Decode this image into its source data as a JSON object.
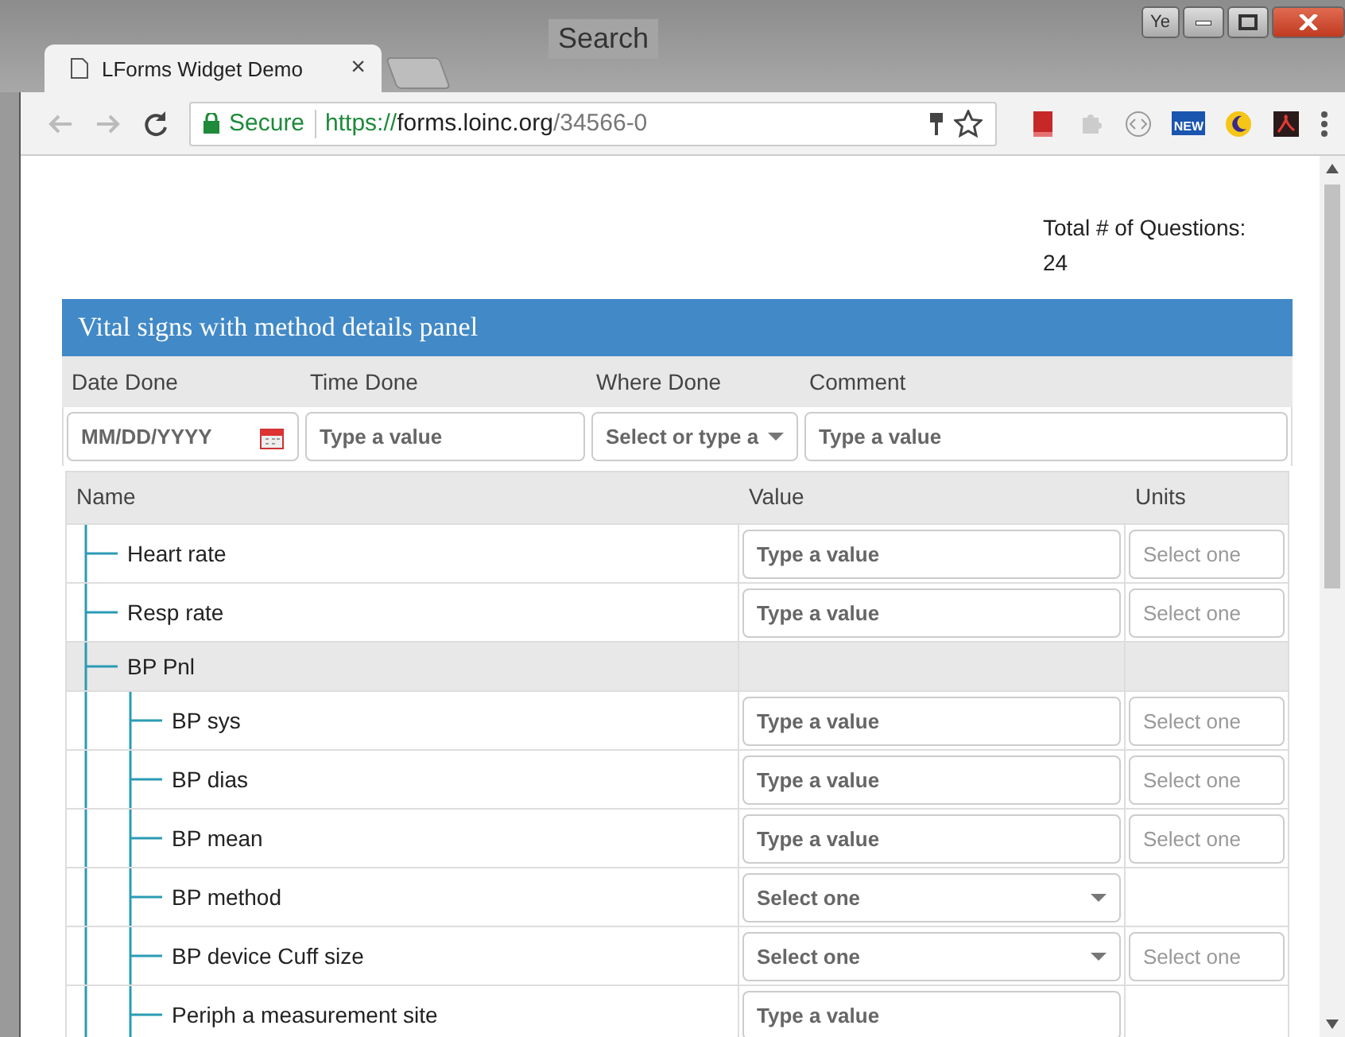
{
  "window": {
    "background_text": "Search",
    "profile": "Ye"
  },
  "tabs": [
    {
      "title": "LForms Widget Demo",
      "close": "×",
      "selected": true
    }
  ],
  "toolbar": {
    "security": "Secure",
    "url": {
      "scheme": "https://",
      "host": "forms.loinc.org",
      "path": "/34566-0"
    },
    "extensions": [
      {
        "kind": "book"
      },
      {
        "kind": "puzzle"
      },
      {
        "kind": "code"
      },
      {
        "kind": "news",
        "label": "NEW"
      },
      {
        "kind": "moon"
      },
      {
        "kind": "pdf"
      }
    ]
  },
  "page": {
    "total_label": "Total # of Questions:",
    "total_count": "24",
    "panel": {
      "title": "Vital signs with method details panel",
      "fields": [
        {
          "label": "Date Done",
          "kind": "date",
          "placeholder": "MM/DD/YYYY"
        },
        {
          "label": "Time Done",
          "kind": "text",
          "placeholder": "Type a value"
        },
        {
          "label": "Where Done",
          "kind": "combo",
          "placeholder": "Select or type a"
        },
        {
          "label": "Comment",
          "kind": "text",
          "placeholder": "Type a value"
        }
      ],
      "columns": [
        "Name",
        "Value",
        "Units"
      ],
      "rows": [
        {
          "name": "Heart rate",
          "value": {
            "kind": "text",
            "placeholder": "Type a value"
          },
          "units": "Select one"
        },
        {
          "name": "Resp rate",
          "value": {
            "kind": "text",
            "placeholder": "Type a value"
          },
          "units": "Select one"
        },
        {
          "name": "BP Pnl",
          "children": [
            {
              "name": "BP sys",
              "value": {
                "kind": "text",
                "placeholder": "Type a value"
              },
              "units": "Select one"
            },
            {
              "name": "BP dias",
              "value": {
                "kind": "text",
                "placeholder": "Type a value"
              },
              "units": "Select one"
            },
            {
              "name": "BP mean",
              "value": {
                "kind": "text",
                "placeholder": "Type a value"
              },
              "units": "Select one"
            },
            {
              "name": "BP method",
              "value": {
                "kind": "select",
                "placeholder": "Select one"
              }
            },
            {
              "name": "BP device Cuff size",
              "value": {
                "kind": "select",
                "placeholder": "Select one"
              },
              "units": "Select one"
            },
            {
              "name": "Periph a measurement site",
              "value": {
                "kind": "text",
                "placeholder": "Type a value"
              }
            }
          ]
        }
      ]
    }
  }
}
